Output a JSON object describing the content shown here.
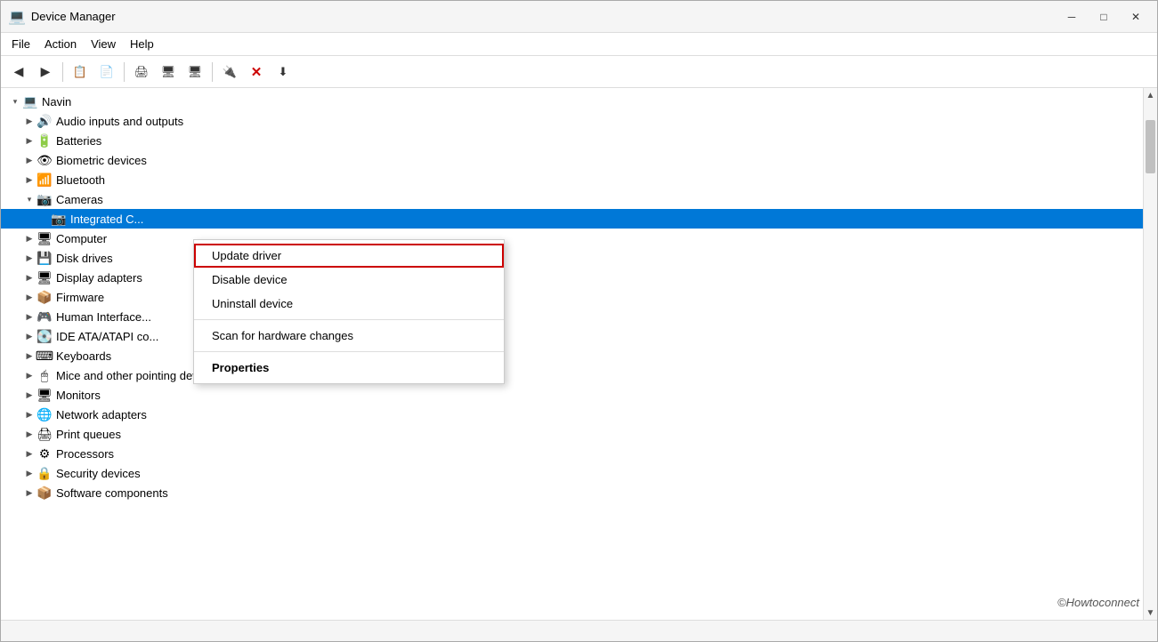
{
  "window": {
    "title": "Device Manager",
    "icon": "💻"
  },
  "title_bar": {
    "title": "Device Manager",
    "minimize_label": "─",
    "maximize_label": "□",
    "close_label": "✕"
  },
  "menu": {
    "items": [
      {
        "id": "file",
        "label": "File"
      },
      {
        "id": "action",
        "label": "Action"
      },
      {
        "id": "view",
        "label": "View"
      },
      {
        "id": "help",
        "label": "Help"
      }
    ]
  },
  "toolbar": {
    "buttons": [
      {
        "id": "back",
        "icon": "◀",
        "label": "Back"
      },
      {
        "id": "forward",
        "icon": "▶",
        "label": "Forward"
      },
      {
        "id": "properties",
        "icon": "📋",
        "label": "Properties"
      },
      {
        "id": "update-driver",
        "icon": "📄",
        "label": "Update Driver"
      },
      {
        "id": "uninstall",
        "icon": "❓",
        "label": "Uninstall"
      },
      {
        "id": "scan",
        "icon": "🖨",
        "label": "Scan"
      },
      {
        "id": "display1",
        "icon": "🖥",
        "label": "Display"
      },
      {
        "id": "display2",
        "icon": "🖥",
        "label": "Display by connection"
      },
      {
        "id": "remove",
        "icon": "🔌",
        "label": "Remove"
      },
      {
        "id": "delete",
        "icon": "✕",
        "label": "Delete"
      },
      {
        "id": "download",
        "icon": "⬇",
        "label": "Download"
      }
    ]
  },
  "tree": {
    "root": {
      "label": "Navin",
      "expanded": true
    },
    "items": [
      {
        "id": "audio",
        "label": "Audio inputs and outputs",
        "icon": "🔊",
        "indent": 1,
        "expanded": false
      },
      {
        "id": "batteries",
        "label": "Batteries",
        "icon": "🔋",
        "indent": 1,
        "expanded": false
      },
      {
        "id": "biometric",
        "label": "Biometric devices",
        "icon": "👁",
        "indent": 1,
        "expanded": false
      },
      {
        "id": "bluetooth",
        "label": "Bluetooth",
        "icon": "📶",
        "indent": 1,
        "expanded": false
      },
      {
        "id": "cameras",
        "label": "Cameras",
        "icon": "📷",
        "indent": 1,
        "expanded": true
      },
      {
        "id": "integrated",
        "label": "Integrated C...",
        "icon": "📷",
        "indent": 2,
        "expanded": false,
        "selected": true
      },
      {
        "id": "computer",
        "label": "Computer",
        "icon": "🖥",
        "indent": 1,
        "expanded": false
      },
      {
        "id": "disk",
        "label": "Disk drives",
        "icon": "💾",
        "indent": 1,
        "expanded": false
      },
      {
        "id": "display",
        "label": "Display adapters",
        "icon": "🖥",
        "indent": 1,
        "expanded": false
      },
      {
        "id": "firmware",
        "label": "Firmware",
        "icon": "📦",
        "indent": 1,
        "expanded": false
      },
      {
        "id": "human",
        "label": "Human Interface...",
        "icon": "🎮",
        "indent": 1,
        "expanded": false
      },
      {
        "id": "ide",
        "label": "IDE ATA/ATAPI co...",
        "icon": "💽",
        "indent": 1,
        "expanded": false
      },
      {
        "id": "keyboards",
        "label": "Keyboards",
        "icon": "⌨",
        "indent": 1,
        "expanded": false
      },
      {
        "id": "mice",
        "label": "Mice and other pointing devices",
        "icon": "🖱",
        "indent": 1,
        "expanded": false
      },
      {
        "id": "monitors",
        "label": "Monitors",
        "icon": "🖥",
        "indent": 1,
        "expanded": false
      },
      {
        "id": "network",
        "label": "Network adapters",
        "icon": "🌐",
        "indent": 1,
        "expanded": false
      },
      {
        "id": "print",
        "label": "Print queues",
        "icon": "🖨",
        "indent": 1,
        "expanded": false
      },
      {
        "id": "processors",
        "label": "Processors",
        "icon": "⚙",
        "indent": 1,
        "expanded": false
      },
      {
        "id": "security",
        "label": "Security devices",
        "icon": "🔒",
        "indent": 1,
        "expanded": false
      },
      {
        "id": "software",
        "label": "Software components",
        "icon": "📦",
        "indent": 1,
        "expanded": false
      }
    ]
  },
  "context_menu": {
    "items": [
      {
        "id": "update-driver",
        "label": "Update driver",
        "highlighted": true,
        "bold": false
      },
      {
        "id": "disable-device",
        "label": "Disable device",
        "highlighted": false,
        "bold": false
      },
      {
        "id": "uninstall-device",
        "label": "Uninstall device",
        "highlighted": false,
        "bold": false
      },
      {
        "id": "scan-changes",
        "label": "Scan for hardware changes",
        "highlighted": false,
        "bold": false
      },
      {
        "id": "properties",
        "label": "Properties",
        "highlighted": false,
        "bold": true
      }
    ],
    "separators_after": [
      2,
      3
    ]
  },
  "watermark": {
    "text": "©Howtoconnect"
  },
  "status_bar": {
    "text": ""
  }
}
